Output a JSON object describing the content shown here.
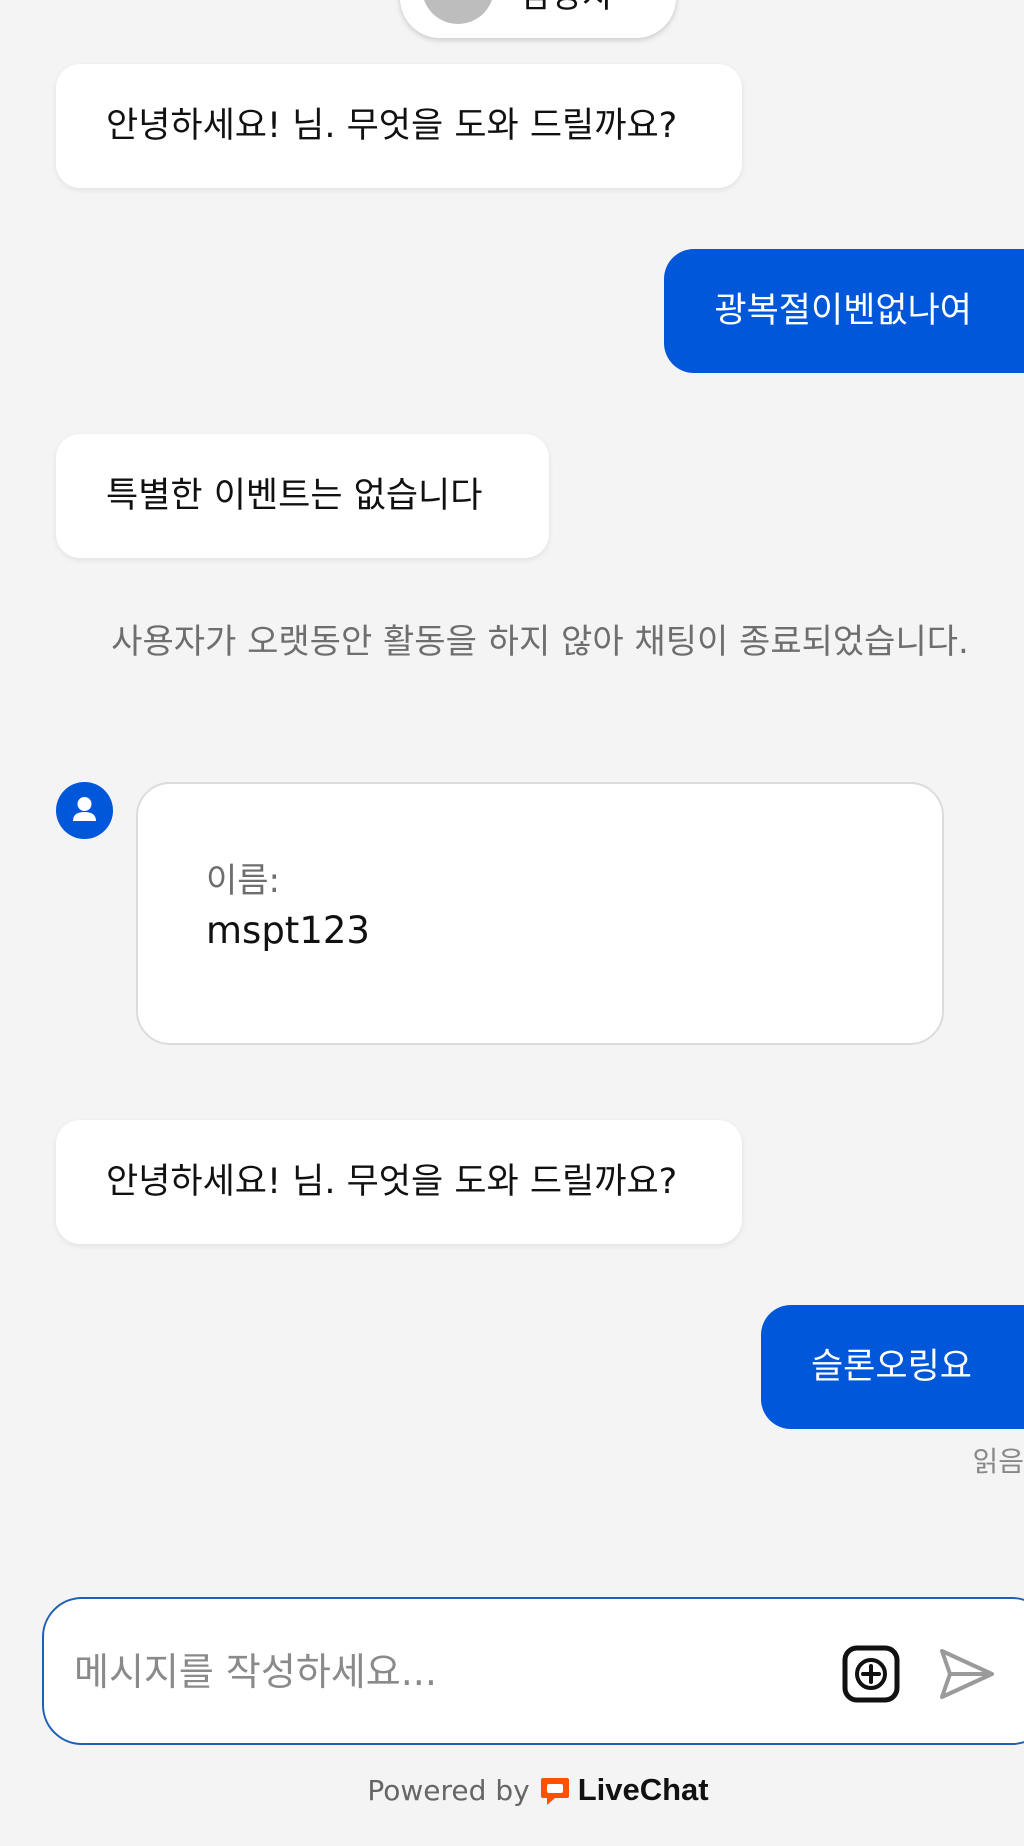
{
  "header": {
    "agent_name": "담당자"
  },
  "messages": [
    {
      "from": "agent",
      "text": "안녕하세요! 님. 무엇을 도와 드릴까요?"
    },
    {
      "from": "user",
      "text": "광복절이벤없나여"
    },
    {
      "from": "agent",
      "text": "특별한 이벤트는 없습니다"
    },
    {
      "from": "system",
      "text": "사용자가 오랫동안 활동을 하지 않아 채팅이 종료되었습니다."
    },
    {
      "from": "form",
      "label": "이름:",
      "value": "mspt123"
    },
    {
      "from": "agent",
      "text": "안녕하세요! 님. 무엇을 도와 드릴까요?"
    },
    {
      "from": "user",
      "text": "슬론오링요"
    }
  ],
  "read_status": "읽음",
  "composer": {
    "placeholder": "메시지를 작성하세요...",
    "value": ""
  },
  "footer": {
    "powered_by": "Powered by",
    "brand": "LiveChat"
  },
  "icons": {
    "avatar": "person-avatar-icon",
    "user": "user-icon",
    "add": "plus-square-icon",
    "send": "send-icon",
    "logo": "livechat-logo-icon"
  },
  "colors": {
    "accent": "#0057d9",
    "background": "#f4f4f4",
    "livechat_orange": "#ff5100"
  }
}
